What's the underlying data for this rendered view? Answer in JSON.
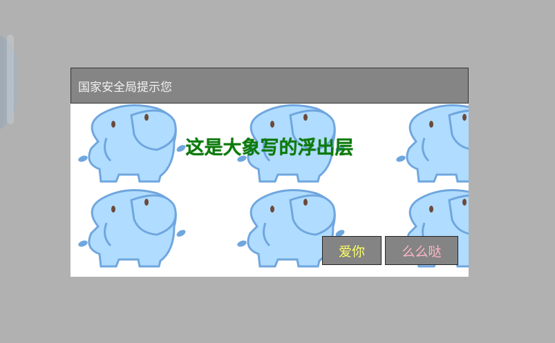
{
  "dialog": {
    "title": "国家安全局提示您",
    "message": "这是大象写的浮出层",
    "buttons": [
      {
        "label": "爱你"
      },
      {
        "label": "么么哒"
      }
    ]
  },
  "colors": {
    "overlay": "#b1b1b1",
    "title_bar": "#858585",
    "message": "#0c7a0c",
    "button_bg": "#848484",
    "button1_text": "#ffff66",
    "button2_text": "#ffb6c8",
    "elephant_fill": "#b0dcff",
    "elephant_outline": "#6fa6de"
  },
  "background_image": "elephant-pattern"
}
